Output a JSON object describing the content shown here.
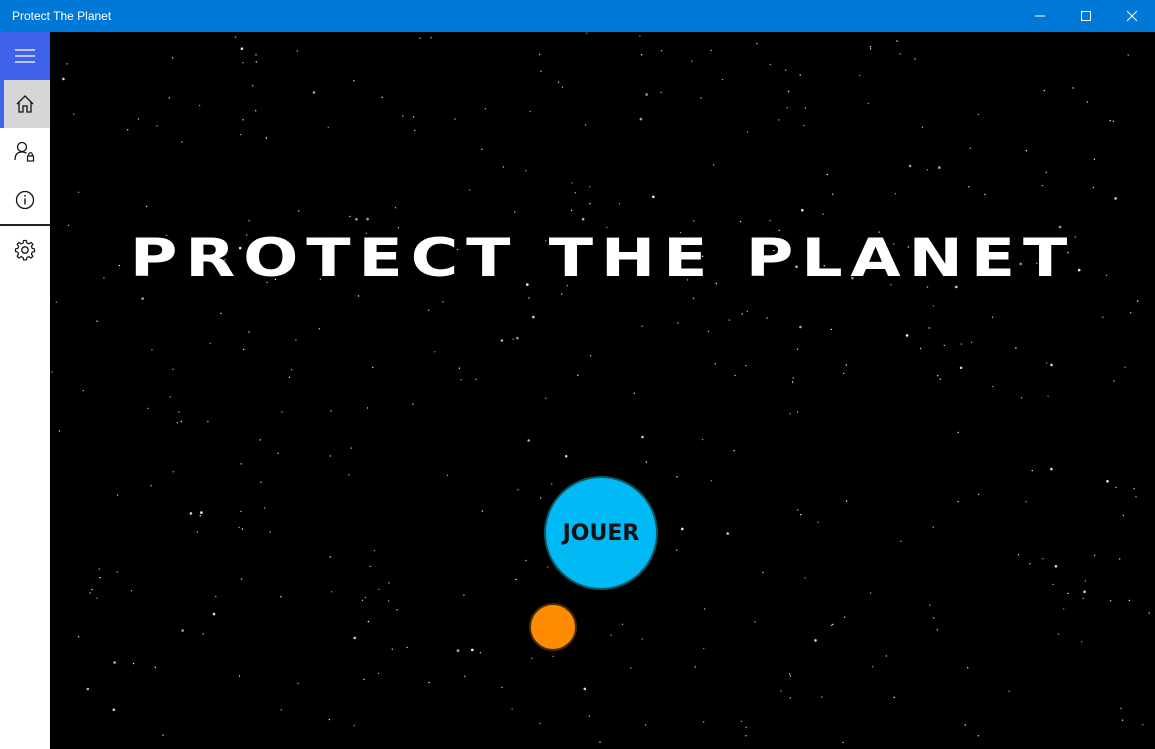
{
  "window": {
    "title": "Protect The Planet",
    "controls": {
      "minimize": "minimize",
      "maximize": "maximize",
      "close": "close"
    },
    "accent": "#0078d7"
  },
  "sidebar": {
    "items": [
      {
        "id": "menu",
        "icon": "hamburger-menu-icon"
      },
      {
        "id": "home",
        "icon": "home-icon",
        "selected": true
      },
      {
        "id": "user",
        "icon": "user-lock-icon"
      },
      {
        "id": "info",
        "icon": "info-icon"
      },
      {
        "id": "settings",
        "icon": "gear-icon"
      }
    ],
    "accent": "#3f63e8"
  },
  "game": {
    "title": "PROTECT THE PLANET",
    "play_label": "JOUER",
    "play_color": "#00b9f5",
    "planet_color": "#ff8c00"
  }
}
